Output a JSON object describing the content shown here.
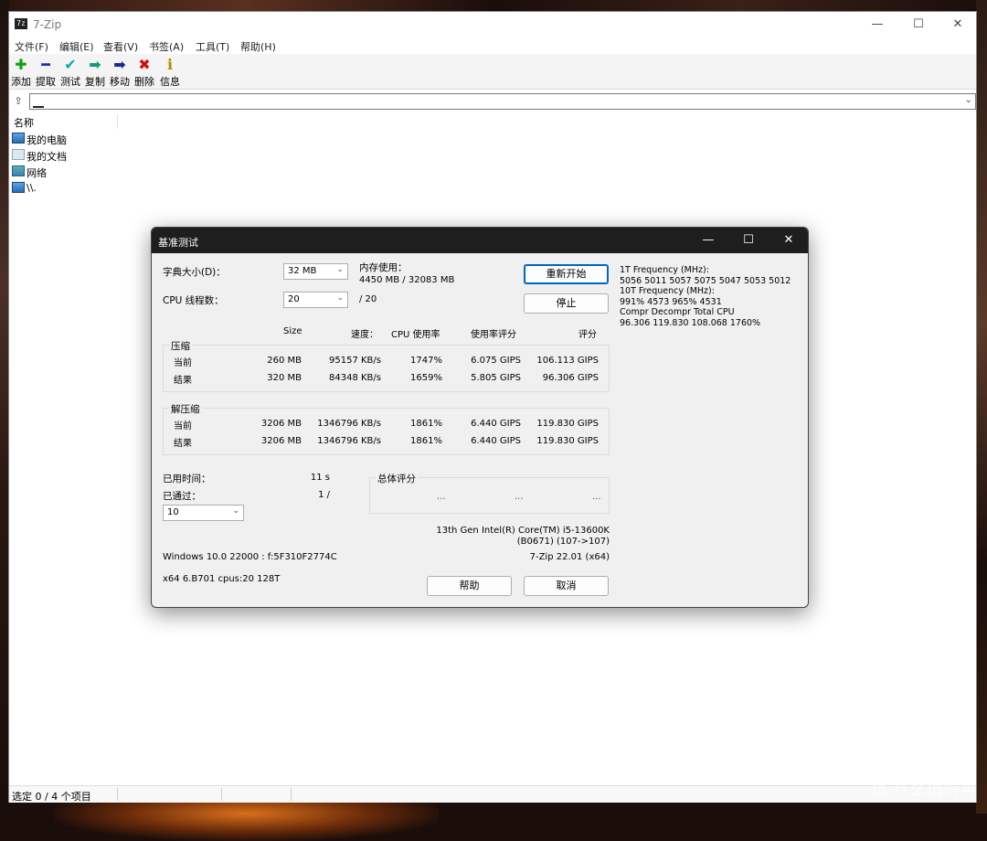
{
  "main_window": {
    "app_icon_text": "7z",
    "title": "7-Zip",
    "controls": [
      "—",
      "☐",
      "✕"
    ],
    "menu": [
      "文件(F)",
      "编辑(E)",
      "查看(V)",
      "书签(A)",
      "工具(T)",
      "帮助(H)"
    ],
    "toolbar": [
      {
        "icon": "plus-icon",
        "glyph": "✚",
        "color": "#12a012",
        "label": "添加"
      },
      {
        "icon": "minus-icon",
        "glyph": "━",
        "color": "#1c2bb0",
        "label": "提取"
      },
      {
        "icon": "check-icon",
        "glyph": "✔",
        "color": "#12a6b0",
        "label": "测试"
      },
      {
        "icon": "copy-arrow-icon",
        "glyph": "➡",
        "color": "#109a80",
        "label": "复制"
      },
      {
        "icon": "move-arrow-icon",
        "glyph": "➡",
        "color": "#1a2a90",
        "label": "移动"
      },
      {
        "icon": "delete-x-icon",
        "glyph": "✖",
        "color": "#d01010",
        "label": "删除"
      },
      {
        "icon": "info-icon",
        "glyph": "ℹ",
        "color": "#b08a00",
        "label": "信息"
      }
    ],
    "column_header": "名称",
    "items": [
      {
        "icon": "computer-icon",
        "label": "我的电脑"
      },
      {
        "icon": "documents-icon",
        "label": "我的文档"
      },
      {
        "icon": "network-icon",
        "label": "网络"
      },
      {
        "icon": "computer-icon",
        "label": "\\\\."
      }
    ],
    "status": "选定 0 / 4 个项目"
  },
  "dialog": {
    "title": "基准测试",
    "controls": [
      "—",
      "☐",
      "✕"
    ],
    "dict_size_label": "字典大小(D)：",
    "dict_size_value": "32 MB",
    "threads_label": "CPU 线程数：",
    "threads_value": "20",
    "threads_total": "/ 20",
    "memory_label": "内存使用：",
    "memory_value": "4450 MB / 32083 MB",
    "restart_button": "重新开始",
    "stop_button": "停止",
    "freq_lines": [
      "1T Frequency (MHz):",
      " 5056 5011 5057 5075 5047 5053 5012",
      "10T Frequency (MHz):",
      " 991% 4573 965% 4531",
      "Compr Decompr Total  CPU",
      "96.306  119.830  108.068  1760%"
    ],
    "columns": {
      "size": "Size",
      "speed": "速度：",
      "cpu": "CPU 使用率",
      "usage_rating": "使用率评分",
      "rating": "评分"
    },
    "compress": {
      "title": "压缩",
      "rows": [
        {
          "label": "当前",
          "size": "260 MB",
          "speed": "95157 KB/s",
          "cpu": "1747%",
          "usage": "6.075 GIPS",
          "rating": "106.113 GIPS"
        },
        {
          "label": "结果",
          "size": "320 MB",
          "speed": "84348 KB/s",
          "cpu": "1659%",
          "usage": "5.805 GIPS",
          "rating": "96.306 GIPS"
        }
      ]
    },
    "decompress": {
      "title": "解压缩",
      "rows": [
        {
          "label": "当前",
          "size": "3206 MB",
          "speed": "1346796 KB/s",
          "cpu": "1861%",
          "usage": "6.440 GIPS",
          "rating": "119.830 GIPS"
        },
        {
          "label": "结果",
          "size": "3206 MB",
          "speed": "1346796 KB/s",
          "cpu": "1861%",
          "usage": "6.440 GIPS",
          "rating": "119.830 GIPS"
        }
      ]
    },
    "elapsed_label": "已用时间：",
    "elapsed_value": "11 s",
    "passes_label": "已通过：",
    "passes_value": "1 /",
    "passes_combo": "10",
    "total_rating_label": "总体评分",
    "total_dots": [
      "...",
      "...",
      "..."
    ],
    "cpu_name": "13th Gen Intel(R) Core(TM) i5-13600K",
    "cpu_id": "(B0671) (107->107)",
    "os_info": "Windows 10.0 22000 : f:5F310F2774C",
    "version": "7-Zip 22.01 (x64)",
    "sys_info": "x64 6.B701 cpus:20 128T",
    "help_button": "帮助",
    "cancel_button": "取消"
  },
  "watermark": "值 什么值得买"
}
